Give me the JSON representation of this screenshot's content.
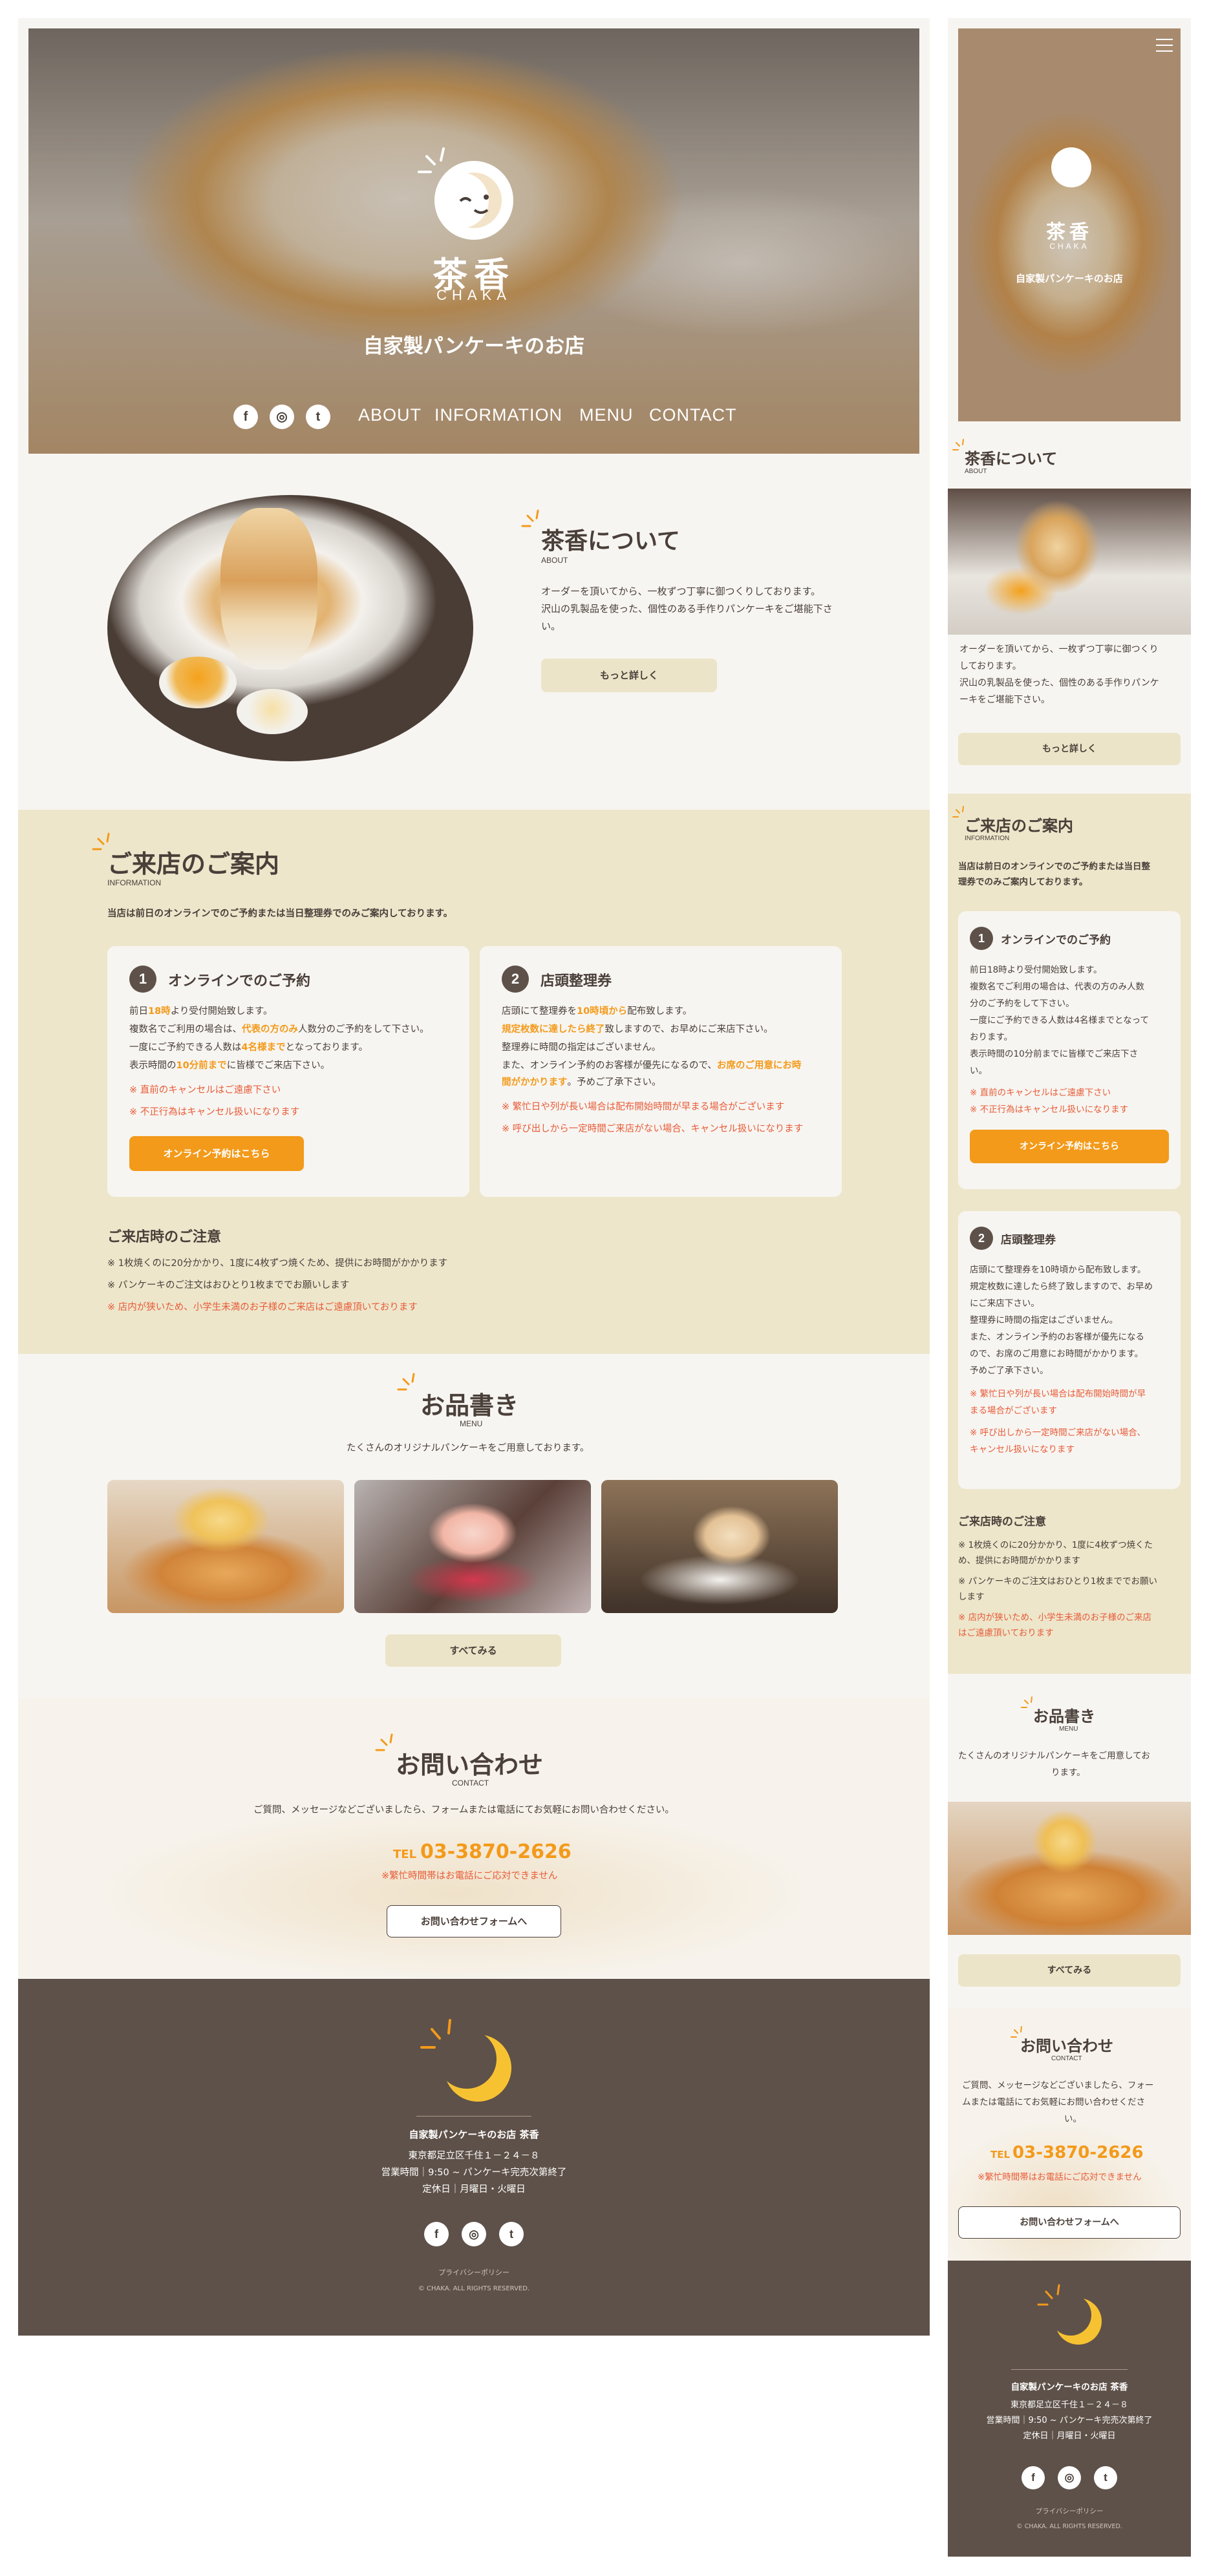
{
  "brand": {
    "kanji": "茶香",
    "roman": "CHAKA",
    "tagline": "自家製パンケーキのお店"
  },
  "nav": {
    "items": [
      "ABOUT",
      "INFORMATION",
      "MENU",
      "CONTACT"
    ],
    "social": [
      "f",
      "◎",
      "t"
    ]
  },
  "about": {
    "title": "茶香について",
    "sub": "ABOUT",
    "text_lines": [
      "オーダーを頂いてから、一枚ずつ丁寧に御つくりしております。",
      "沢山の乳製品を使った、個性のある手作りパンケーキをご堪能下さ",
      "い。"
    ],
    "button": "もっと詳しく"
  },
  "info": {
    "title": "ご来店のご案内",
    "sub": "INFORMATION",
    "lead": "当店は前日のオンラインでのご予約または当日整理券でのみご案内しております。",
    "card1": {
      "num": "1",
      "title": "オンラインでのご予約",
      "l1a": "前日",
      "l1b": "18時",
      "l1c": "より受付開始致します。",
      "l2a": "複数名でご利用の場合は、",
      "l2b": "代表の方のみ",
      "l2c": "人数分のご予約をして下さい。",
      "l3a": "一度にご予約できる人数は",
      "l3b": "4名様まで",
      "l3c": "となっております。",
      "l4a": "表示時間の",
      "l4b": "10分前まで",
      "l4c": "に皆様でご来店下さい。",
      "n1": "※ 直前のキャンセルはご遠慮下さい",
      "n2": "※ 不正行為はキャンセル扱いになります",
      "button": "オンライン予約はこちら"
    },
    "card2": {
      "num": "2",
      "title": "店頭整理券",
      "l1a": "店頭にて整理券を",
      "l1b": "10時頃から",
      "l1c": "配布致します。",
      "l2a": "規定枚数に達したら終了",
      "l2b": "致しますので、お早めにご来店下さい。",
      "l3": "整理券に時間の指定はございません。",
      "l4a": "また、オンライン予約のお客様が優先になるので、",
      "l4b": "お席のご用意にお時",
      "l5a": "間がかかります",
      "l5b": "。予めご了承下さい。",
      "n1": "※ 繁忙日や列が長い場合は配布開始時間が早まる場合がございます",
      "n2": "※ 呼び出しから一定時間ご来店がない場合、キャンセル扱いになります"
    },
    "notes_title": "ご来店時のご注意",
    "notes": [
      "※ 1枚焼くのに20分かかり、1度に4枚ずつ焼くため、提供にお時間がかかります",
      "※ パンケーキのご注文はおひとり1枚まででお願いします",
      "※ 店内が狭いため、小学生未満のお子様のご来店はご遠慮頂いております"
    ]
  },
  "menu": {
    "title": "お品書き",
    "sub": "MENU",
    "lead": "たくさんのオリジナルパンケーキをご用意しております。",
    "button": "すべてみる"
  },
  "contact": {
    "title": "お問い合わせ",
    "sub": "CONTACT",
    "lead": "ご質問、メッセージなどございましたら、フォームまたは電話にてお気軽にお問い合わせください。",
    "tel_label": "TEL",
    "tel": "03-3870-2626",
    "tel_note": "※繁忙時間帯はお電話にご応対できません",
    "button": "お問い合わせフォームへ"
  },
  "footer": {
    "name": "自家製パンケーキのお店 茶香",
    "address": "東京都足立区千住１－２４－８",
    "hours": "営業時間｜9:50 ~ パンケーキ完売次第終了",
    "closed": "定休日｜月曜日・火曜日",
    "privacy": "プライバシーポリシー",
    "copyright": "© CHAKA. ALL RIGHTS RESERVED."
  },
  "mobile": {
    "about_lines": [
      "オーダーを頂いてから、一枚ずつ丁寧に御つくり",
      "しております。",
      "沢山の乳製品を使った、個性のある手作りパンケ",
      "ーキをご堪能下さい。"
    ],
    "info_lead": [
      "当店は前日のオンラインでのご予約または当日整",
      "理券でのみご案内しております。"
    ],
    "card1_lines": [
      "前日18時より受付開始致します。",
      "複数名でご利用の場合は、代表の方のみ人数",
      "分のご予約をして下さい。",
      "一度にご予約できる人数は4名様までとなって",
      "おります。",
      "表示時間の10分前までに皆様でご来店下さ",
      "い。"
    ],
    "card1_notes": [
      "※ 直前のキャンセルはご遠慮下さい",
      "※ 不正行為はキャンセル扱いになります"
    ],
    "card2_lines": [
      "店頭にて整理券を10時頃から配布致します。",
      "規定枚数に達したら終了致しますので、お早め",
      "にご来店下さい。",
      "整理券に時間の指定はございません。",
      "また、オンライン予約のお客様が優先になる",
      "ので、お席のご用意にお時間がかかります。",
      "予めご了承下さい。"
    ],
    "card2_notes": [
      "※ 繁忙日や列が長い場合は配布開始時間が早",
      "まる場合がございます",
      "※ 呼び出しから一定時間ご来店がない場合、",
      "キャンセル扱いになります"
    ],
    "notes": [
      "※ 1枚焼くのに20分かかり、1度に4枚ずつ焼くた",
      "め、提供にお時間がかかります",
      "※ パンケーキのご注文はおひとり1枚まででお願い",
      "します",
      "※ 店内が狭いため、小学生未満のお子様のご来店",
      "はご遠慮頂いております"
    ],
    "menu_lead": [
      "たくさんのオリジナルパンケーキをご用意してお",
      "ります。"
    ],
    "contact_lead": [
      "ご質問、メッセージなどございましたら、フォー",
      "ムまたは電話にてお気軽にお問い合わせくださ",
      "い。"
    ]
  },
  "colors": {
    "accent": "#f39a1a",
    "beige": "#ede6cb",
    "brown": "#5e5149",
    "red": "#e85b38",
    "background": "#f7f5f1"
  }
}
